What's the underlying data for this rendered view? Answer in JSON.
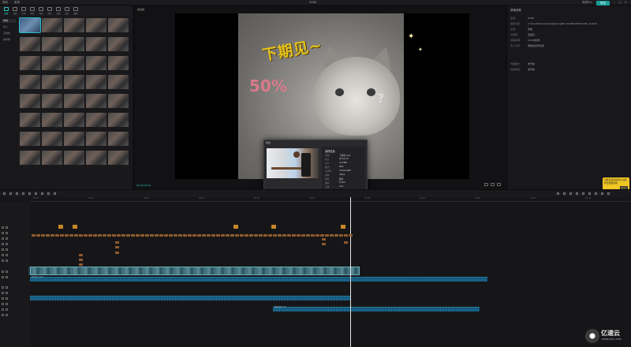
{
  "titlebar": {
    "menu_items": [
      "剪映",
      "菜单"
    ],
    "title": "0308",
    "export_label": "导出",
    "user_label": "剪映Pro"
  },
  "media_panel": {
    "tools": [
      {
        "label": "媒体",
        "icon": "media-icon",
        "active": true
      },
      {
        "label": "音频",
        "icon": "audio-icon"
      },
      {
        "label": "文本",
        "icon": "text-icon"
      },
      {
        "label": "贴纸",
        "icon": "sticker-icon"
      },
      {
        "label": "特效",
        "icon": "effects-icon"
      },
      {
        "label": "转场",
        "icon": "transition-icon"
      },
      {
        "label": "滤镜",
        "icon": "filter-icon"
      },
      {
        "label": "调节",
        "icon": "adjust-icon"
      },
      {
        "label": "模板",
        "icon": "template-icon"
      }
    ],
    "side_items": [
      "本地",
      "导入",
      "云素材",
      "素材库"
    ],
    "thumb_count": 40
  },
  "player": {
    "title": "播放器",
    "overlay_text": "下期见~",
    "percent_text": "50%",
    "question_mark": "?",
    "timecode": "00:00:00:00"
  },
  "properties": {
    "title": "草稿参数",
    "rows": [
      {
        "key": "名称:",
        "value": "0308"
      },
      {
        "key": "保存位置:",
        "value": "C:/Users/Documents/JianyingPro Drafts/0308/draft_content"
      },
      {
        "key": "比例:",
        "value": "原始"
      },
      {
        "key": "分辨率:",
        "value": "自适应"
      },
      {
        "key": "草稿帧率:",
        "value": "30.00帧/秒"
      },
      {
        "key": "导入方式:",
        "value": "保留在原有位置"
      },
      {
        "key": "代理模式:",
        "value": "未开启"
      },
      {
        "key": "自由层级:",
        "value": "未开启"
      }
    ]
  },
  "tooltip": {
    "text": "音频已经自动对齐,请到导出页面查看",
    "ok_label": "知道了"
  },
  "dialog": {
    "title": "导出",
    "header": "素材信息",
    "rows": [
      {
        "key": "名称:",
        "value": "下期见.mp4"
      },
      {
        "key": "时长:",
        "value": "00:00:15"
      },
      {
        "key": "大小:",
        "value": "24.6MB"
      },
      {
        "key": "格式:",
        "value": "MP4"
      },
      {
        "key": "分辨率:",
        "value": "1920x1080"
      },
      {
        "key": "帧率:",
        "value": "30fps"
      },
      {
        "key": "码率:",
        "value": "推荐"
      },
      {
        "key": "编码:",
        "value": "H.264"
      },
      {
        "key": "音频:",
        "value": "AAC"
      },
      {
        "key": "创建时间:",
        "value": "2021-03-08"
      }
    ],
    "footer_text": "导出中",
    "button_label": "取消"
  },
  "timeline": {
    "ruler_ticks": [
      "00:00",
      "00:10",
      "00:20",
      "00:30",
      "00:40",
      "00:50",
      "01:00",
      "01:10",
      "01:20",
      "01:30",
      "01:40"
    ],
    "audio_labels": [
      "背景音乐.mp3",
      "解说音频.mp3"
    ]
  },
  "watermark": {
    "brand": "亿速云",
    "site": "www.yisu.com"
  }
}
